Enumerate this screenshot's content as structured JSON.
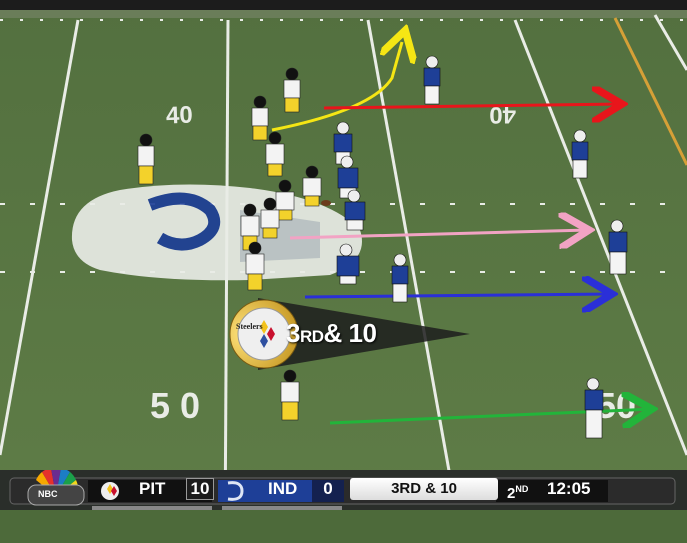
{
  "field": {
    "yard_numbers": [
      "40",
      "50"
    ],
    "turf_color": "#5c7a45",
    "line_color": "#e9ece6"
  },
  "graphic": {
    "team_logo_word": "Steelers",
    "down_number": "3",
    "down_suffix": "RD",
    "amp_distance": "& 10"
  },
  "scoreboard": {
    "network": "NBC",
    "home_team": "PIT",
    "home_score": "10",
    "away_team": "IND",
    "away_score": "0",
    "down_distance": "3RD & 10",
    "quarter": "2",
    "quarter_suffix": "ND",
    "clock": "12:05"
  },
  "routes": [
    {
      "color": "#f5e614",
      "type": "go"
    },
    {
      "color": "#e8151b",
      "type": "straight"
    },
    {
      "color": "#f2a3c4",
      "type": "straight"
    },
    {
      "color": "#2a2fd8",
      "type": "straight"
    },
    {
      "color": "#22b43a",
      "type": "straight"
    }
  ],
  "colors": {
    "steelers_gold": "#f3d22b",
    "steelers_black": "#111111",
    "colts_blue": "#1e3f97",
    "colts_white": "#f4f4f4"
  }
}
